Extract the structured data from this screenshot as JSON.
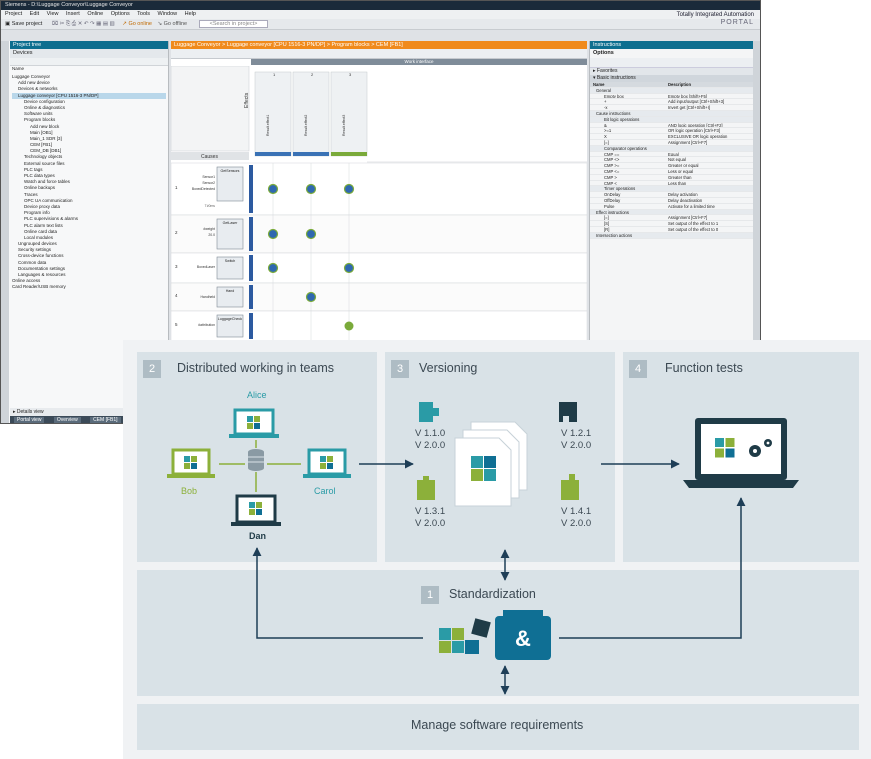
{
  "tia": {
    "title": "Siemens - D:\\Luggage Conveyor\\Luggage Conveyor",
    "menu": [
      "Project",
      "Edit",
      "View",
      "Insert",
      "Online",
      "Options",
      "Tools",
      "Window",
      "Help"
    ],
    "toolbar": {
      "save": "Save project",
      "go_online": "Go online",
      "go_offline": "Go offline",
      "search": "<Search in project>"
    },
    "brand": {
      "line1": "Totally Integrated Automation",
      "line2": "PORTAL"
    },
    "project_tree": {
      "title": "Project tree",
      "tab": "Devices",
      "column": "Name",
      "items": [
        "Luggage Conveyor",
        "Add new device",
        "Devices & networks",
        "Luggage conveyor [CPU 1516-3 PN/DP]",
        "Device configuration",
        "Online & diagnostics",
        "Software units",
        "Program blocks",
        "Add new block",
        "Main [OB1]",
        "Main_1 SDR [3]",
        "CEM [FB1]",
        "CEM_DB [DB1]",
        "Technology objects",
        "External source files",
        "PLC tags",
        "PLC data types",
        "Watch and force tables",
        "Online backups",
        "Traces",
        "OPC UA communication",
        "Device proxy data",
        "Program info",
        "PLC supervisions & alarms",
        "PLC alarm text lists",
        "Online card data",
        "Local modules",
        "Ungrouped devices",
        "Security settings",
        "Cross-device functions",
        "Common data",
        "Documentation settings",
        "Languages & resources",
        "Online access",
        "Card Reader/USB memory"
      ],
      "details": "Details view",
      "bottom_tabs": [
        "Portal view",
        "Overview",
        "CEM [FB1]"
      ]
    },
    "editor": {
      "title": "Luggage Conveyor > Luggage conveyor [CPU 1516-3 PN/DP] > Program blocks > CEM [FB1]",
      "work_interface": "Work interface",
      "effects": "Effects",
      "causes": "Causes",
      "cause_rows": [
        {
          "n": "1",
          "box": "GetSensors",
          "inputs": [
            "Sensor1",
            "Sensor2",
            "BoxedDetected"
          ],
          "extra": "T#0ms"
        },
        {
          "n": "2",
          "box": "GetLaser",
          "inputs": [
            "#weight",
            "20.0"
          ]
        },
        {
          "n": "3",
          "box": "Switch",
          "inputs": [
            "BoxedLaser"
          ]
        },
        {
          "n": "4",
          "box": "Hand",
          "inputs": [
            "Handheld"
          ]
        },
        {
          "n": "5",
          "box": "LuggageCheck",
          "inputs": [
            "#attribution"
          ]
        }
      ],
      "effect_cols": [
        {
          "n": "1",
          "label": "Result.effect1"
        },
        {
          "n": "2",
          "label": "Result.effect2"
        },
        {
          "n": "3",
          "label": "Result.effect3"
        }
      ]
    },
    "tasks": {
      "title": "Instructions",
      "options": "Options",
      "favorites": "Favorites",
      "basic": "Basic instructions",
      "columns": [
        "Name",
        "Description"
      ],
      "rows": [
        {
          "t": "grp",
          "name": "General"
        },
        {
          "name": "Empty box",
          "desc": "Empty box [Shift+F5]"
        },
        {
          "name": "+",
          "desc": "Add input/output [Ctrl+Shift+3]"
        },
        {
          "name": "-x",
          "desc": "Invert get [Ctrl+Shift+I]"
        },
        {
          "t": "grp",
          "name": "Cause instructions"
        },
        {
          "t": "sub",
          "name": "Bit logic operations"
        },
        {
          "name": "&",
          "desc": "AND logic operation [Ctrl+F2]"
        },
        {
          "name": ">=1",
          "desc": "OR logic operation [Ctrl+F3]"
        },
        {
          "name": "X",
          "desc": "EXCLUSIVE OR logic operation"
        },
        {
          "name": "[=]",
          "desc": "Assignment [Ctrl+F7]"
        },
        {
          "t": "sub",
          "name": "Comparator operations"
        },
        {
          "name": "CMP ==",
          "desc": "Equal"
        },
        {
          "name": "CMP <>",
          "desc": "Not equal"
        },
        {
          "name": "CMP >=",
          "desc": "Greater or equal"
        },
        {
          "name": "CMP <=",
          "desc": "Less or equal"
        },
        {
          "name": "CMP >",
          "desc": "Greater than"
        },
        {
          "name": "CMP <",
          "desc": "Less than"
        },
        {
          "t": "sub",
          "name": "Timer operations"
        },
        {
          "name": "OnDelay",
          "desc": "Delay activation"
        },
        {
          "name": "OffDelay",
          "desc": "Delay deactivation"
        },
        {
          "name": "Pulse",
          "desc": "Activate for a limited time"
        },
        {
          "t": "grp",
          "name": "Effect instructions"
        },
        {
          "name": "[=]",
          "desc": "Assignment [Ctrl+F7]"
        },
        {
          "name": "[S]",
          "desc": "Set output of the effect to 1"
        },
        {
          "name": "[R]",
          "desc": "Set output of the effect to 0"
        },
        {
          "t": "grp",
          "name": "Intersection actions"
        }
      ]
    }
  },
  "infographic": {
    "panel2": {
      "num": "2",
      "title": "Distributed working in teams",
      "names": {
        "alice": "Alice",
        "bob": "Bob",
        "carol": "Carol",
        "dan": "Dan"
      }
    },
    "panel3": {
      "num": "3",
      "title": "Versioning",
      "v1": [
        "V 1.1.0",
        "V 2.0.0"
      ],
      "v2": [
        "V 1.2.1",
        "V 2.0.0"
      ],
      "v3": [
        "V 1.3.1",
        "V 2.0.0"
      ],
      "v4": [
        "V 1.4.1",
        "V 2.0.0"
      ]
    },
    "panel4": {
      "num": "4",
      "title": "Function tests"
    },
    "panel1": {
      "num": "1",
      "title": "Standardization",
      "amp": "&"
    },
    "panel0": {
      "title": "Manage software requirements"
    },
    "colors": {
      "green": "#8cb03a",
      "teal": "#2a9ba6",
      "blue": "#0f6f94",
      "dark": "#1f3b47",
      "panel": "#d9e2e7",
      "arrow": "#1e3e57"
    }
  }
}
